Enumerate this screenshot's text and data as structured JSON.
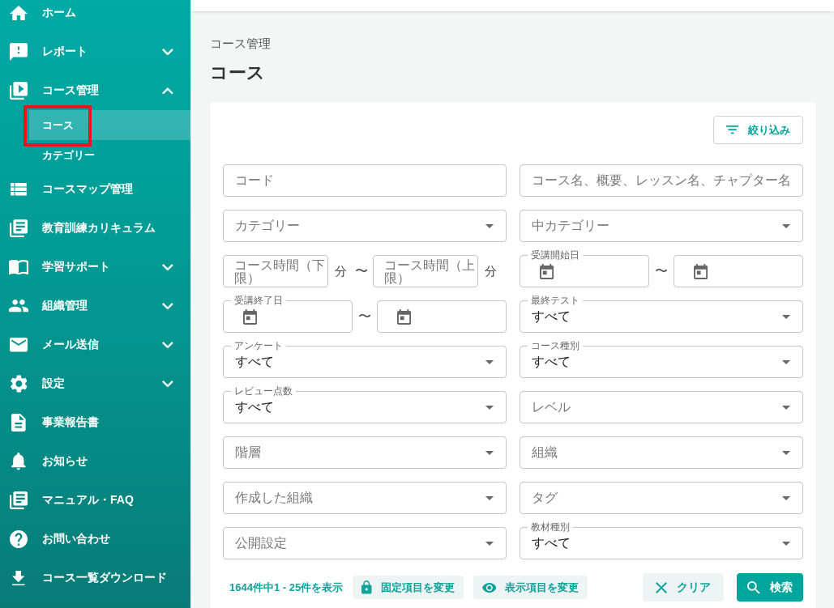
{
  "sidebar": {
    "items": [
      {
        "label": "ホーム"
      },
      {
        "label": "レポート",
        "expanded": false
      },
      {
        "label": "コース管理",
        "expanded": true,
        "children": [
          {
            "label": "コース",
            "selected": true,
            "outlined": true
          },
          {
            "label": "カテゴリー",
            "selected": false,
            "outlined": false
          }
        ]
      },
      {
        "label": "コースマップ管理"
      },
      {
        "label": "教育訓練カリキュラム"
      },
      {
        "label": "学習サポート",
        "expanded": false
      },
      {
        "label": "組織管理",
        "expanded": false
      },
      {
        "label": "メール送信",
        "expanded": false
      },
      {
        "label": "設定",
        "expanded": false
      },
      {
        "label": "事業報告書"
      },
      {
        "label": "お知らせ"
      },
      {
        "label": "マニュアル・FAQ"
      },
      {
        "label": "お問い合わせ"
      },
      {
        "label": "コース一覧ダウンロード"
      }
    ]
  },
  "header": {
    "breadcrumb": "コース管理",
    "title": "コース"
  },
  "filter_panel": {
    "filter_button": "絞り込み",
    "filter_rows": [
      [
        {
          "kind": "text",
          "placeholder": "コード"
        },
        {
          "kind": "text",
          "placeholder": "コース名、概要、レッスン名、チャプター名"
        }
      ],
      [
        {
          "kind": "select",
          "placeholder": "カテゴリー"
        },
        {
          "kind": "select",
          "placeholder": "中カテゴリー"
        }
      ],
      [
        {
          "kind": "number_range",
          "from": {
            "placeholder": "コース時間（下限）",
            "unit": "分"
          },
          "separator": "〜",
          "to": {
            "placeholder": "コース時間（上限）",
            "unit": "分"
          }
        },
        {
          "kind": "date_range",
          "label": "受講開始日",
          "separator": "〜"
        }
      ],
      [
        {
          "kind": "date_range",
          "label": "受講終了日",
          "separator": "〜"
        },
        {
          "kind": "select",
          "label": "最終テスト",
          "value": "すべて"
        }
      ],
      [
        {
          "kind": "select",
          "label": "アンケート",
          "value": "すべて"
        },
        {
          "kind": "select",
          "label": "コース種別",
          "value": "すべて"
        }
      ],
      [
        {
          "kind": "select",
          "label": "レビュー点数",
          "value": "すべて"
        },
        {
          "kind": "select",
          "placeholder": "レベル"
        }
      ],
      [
        {
          "kind": "select",
          "placeholder": "階層"
        },
        {
          "kind": "select",
          "placeholder": "組織"
        }
      ],
      [
        {
          "kind": "select",
          "placeholder": "作成した組織"
        },
        {
          "kind": "select",
          "placeholder": "タグ"
        }
      ],
      [
        {
          "kind": "select",
          "placeholder": "公開設定"
        },
        {
          "kind": "select",
          "label": "教材種別",
          "value": "すべて"
        }
      ]
    ],
    "result_count": "1644件中1 - 25件を表示",
    "tools": [
      {
        "label": "固定項目を変更"
      },
      {
        "label": "表示項目を変更"
      }
    ],
    "buttons": [
      {
        "kind": "secondary",
        "label": "クリア"
      },
      {
        "kind": "primary",
        "label": "検索"
      }
    ]
  }
}
